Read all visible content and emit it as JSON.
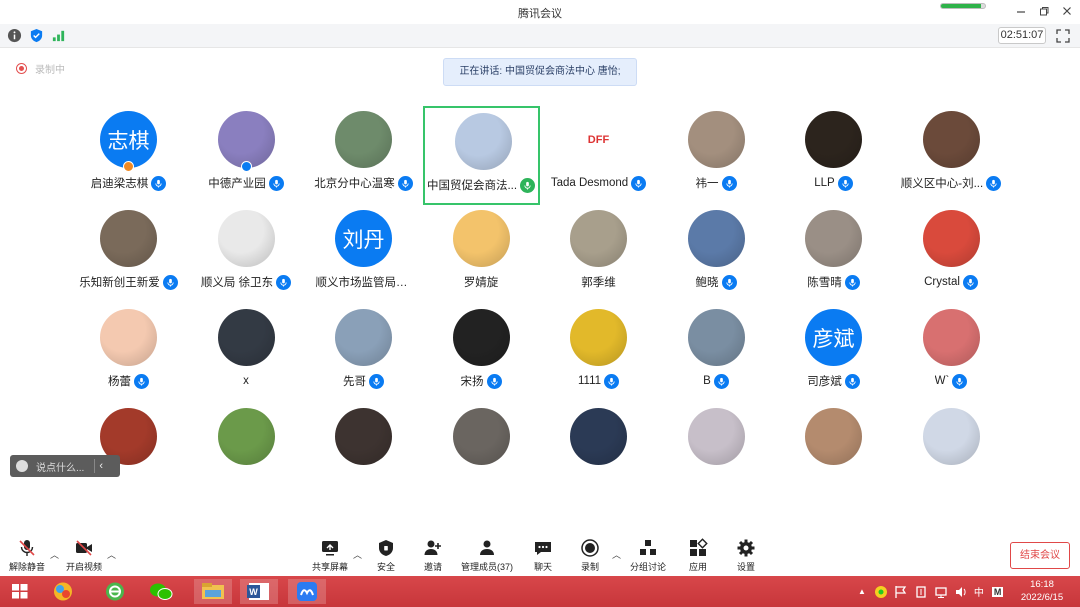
{
  "window": {
    "title": "腾讯会议"
  },
  "network_quality": 0.9,
  "infobar": {
    "timer": "02:51:07"
  },
  "recording": {
    "label": "录制中"
  },
  "speaking": {
    "text": "正在讲话: 中国贸促会商法中心 唐怡;"
  },
  "participants": [
    {
      "name": "启迪梁志棋",
      "avatar_text": "志棋",
      "badge": "host"
    },
    {
      "name": "中德产业园",
      "badge": "cohost"
    },
    {
      "name": "北京分中心温寒"
    },
    {
      "name": "中国贸促会商法...",
      "active": true,
      "mic": "green"
    },
    {
      "name": "Tada Desmond",
      "logo_text": "DFF"
    },
    {
      "name": "祎一"
    },
    {
      "name": "LLP"
    },
    {
      "name": "顺义区中心-刘..."
    },
    {
      "name": "乐知新创王新爱"
    },
    {
      "name": "顺义局 徐卫东"
    },
    {
      "name": "顺义市场监管局刘丹",
      "avatar_text": "刘丹",
      "no_mic": true
    },
    {
      "name": "罗婧旋",
      "no_mic": true
    },
    {
      "name": "郭季维",
      "no_mic": true
    },
    {
      "name": "鲍晓"
    },
    {
      "name": "陈雪晴"
    },
    {
      "name": "Crystal"
    },
    {
      "name": "杨蕾"
    },
    {
      "name": "x",
      "no_mic": true
    },
    {
      "name": "先哥"
    },
    {
      "name": "宋扬"
    },
    {
      "name": "1111"
    },
    {
      "name": "B"
    },
    {
      "name": "司彦斌",
      "avatar_text": "彦斌"
    },
    {
      "name": "W`"
    },
    {
      "name": ""
    },
    {
      "name": ""
    },
    {
      "name": ""
    },
    {
      "name": ""
    },
    {
      "name": ""
    },
    {
      "name": ""
    },
    {
      "name": ""
    },
    {
      "name": ""
    }
  ],
  "chat": {
    "placeholder": "说点什么..."
  },
  "toolbar": {
    "mute": "解除静音",
    "video": "开启视频",
    "share": "共享屏幕",
    "security": "安全",
    "invite": "邀请",
    "members": "管理成员(37)",
    "chat": "聊天",
    "record": "录制",
    "breakout": "分组讨论",
    "apps": "应用",
    "settings": "设置",
    "end": "结束会议"
  },
  "taskbar": {
    "ime": "中",
    "ime2": "M",
    "time": "16:18",
    "date": "2022/6/15"
  },
  "colors": {
    "accent": "#0a7bf2",
    "end": "#e04848",
    "taskbar": "#c7363b",
    "active": "#36c46a"
  }
}
